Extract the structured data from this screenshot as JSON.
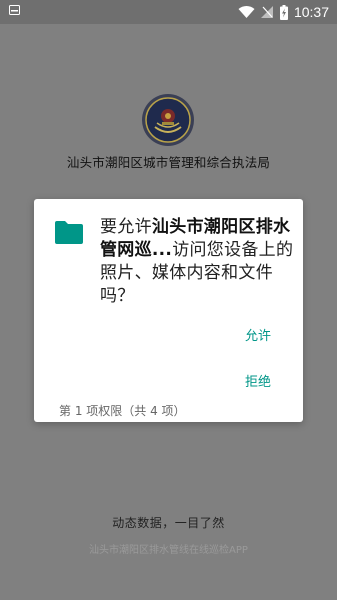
{
  "status_bar": {
    "time": "10:37",
    "icons": [
      "notification-icon",
      "wifi-icon",
      "signal-icon",
      "battery-charging-icon"
    ]
  },
  "background": {
    "org_title": "汕头市潮阳区城市管理和综合执法局",
    "slogan": "动态数据，一目了然",
    "subtitle": "汕头市潮阳区排水管线在线巡检APP"
  },
  "dialog": {
    "prefix": "要允许",
    "app_name": "汕头市潮阳区排水管网巡...",
    "suffix": "访问您设备上的照片、媒体内容和文件吗？",
    "allow_label": "允许",
    "deny_label": "拒绝",
    "permission_count": "第 1 项权限（共 4 项）",
    "icon": "folder-icon",
    "accent_color": "#009688"
  }
}
